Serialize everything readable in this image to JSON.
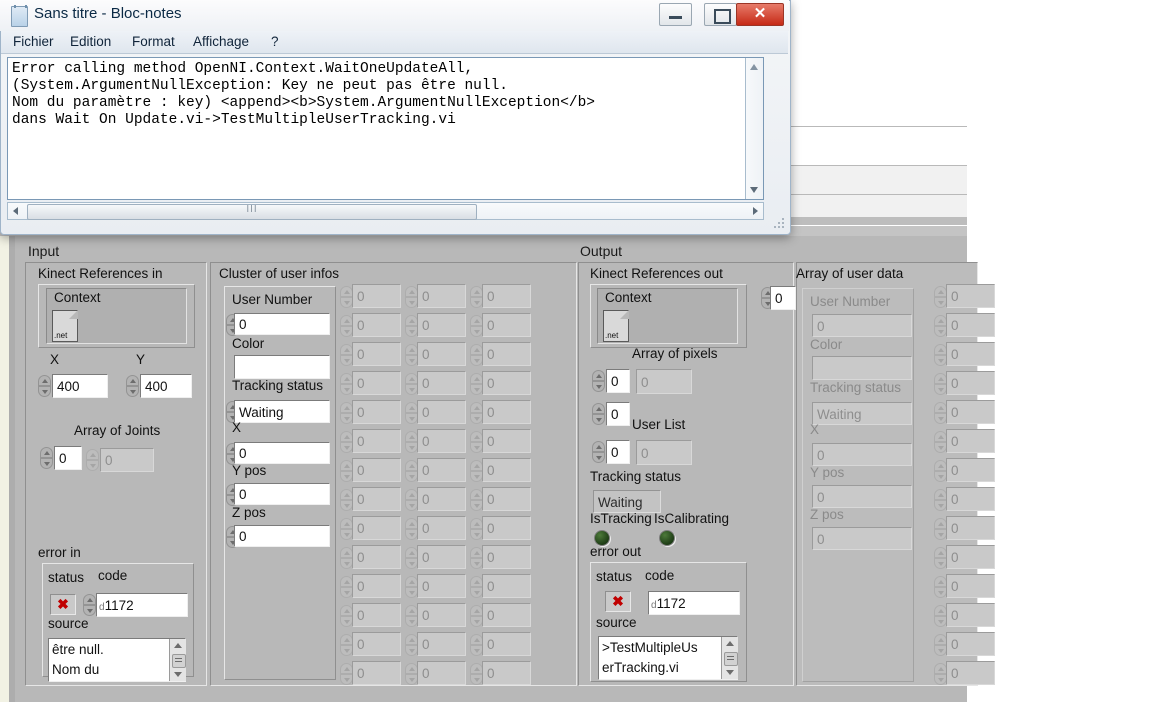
{
  "notepad": {
    "title": "Sans titre - Bloc-notes",
    "icon": "notepad-icon",
    "menus": [
      "Fichier",
      "Edition",
      "Format",
      "Affichage",
      "?"
    ],
    "buttons": {
      "minimize": "minimize-button",
      "maximize": "maximize-button",
      "close": "✕"
    },
    "text_lines": [
      "Error calling method OpenNI.Context.WaitOneUpdateAll,",
      "(System.ArgumentNullException: Key ne peut pas être null.",
      "Nom du paramètre : key) <append><b>System.ArgumentNullException</b>",
      "dans Wait On Update.vi->TestMultipleUserTracking.vi"
    ]
  },
  "panel": {
    "input": {
      "section_title": "Input",
      "kinect_refs": {
        "title": "Kinect References in",
        "context_label": "Context",
        "dotnet_badge": ".net",
        "x_label": "X",
        "x_value": "400",
        "y_label": "Y",
        "y_value": "400",
        "joints_label": "Array of Joints",
        "joints_index": "0",
        "joints_value": "0"
      },
      "error_in": {
        "title": "error in",
        "status_label": "status",
        "code_label": "code",
        "status_icon": "✖",
        "code_prefix": "d",
        "code_value": "1172",
        "source_label": "source",
        "source_lines": [
          "être null.",
          "Nom du"
        ]
      }
    },
    "cluster": {
      "title": "Cluster of user infos",
      "fields": [
        {
          "label": "User Number",
          "value": "0"
        },
        {
          "label": "Color",
          "value": ""
        },
        {
          "label": "Tracking status",
          "value": "Waiting"
        },
        {
          "label": "X",
          "value": "0"
        },
        {
          "label": "Y pos",
          "value": "0"
        },
        {
          "label": "Z pos",
          "value": "0"
        }
      ],
      "grid_columns": 3,
      "grid_rows": 14,
      "grid_value": "0"
    },
    "output": {
      "section_title": "Output",
      "kinect_refs": {
        "title": "Kinect References out",
        "context_label": "Context",
        "dotnet_badge": ".net",
        "pixels_label": "Array of pixels",
        "pixels_index_1": "0",
        "pixels_value_1": "0",
        "pixels_index_2": "0",
        "userlist_label": "User List",
        "userlist_index": "0",
        "userlist_value": "0",
        "tracking_label": "Tracking status",
        "tracking_value": "Waiting",
        "istracking_label": "IsTracking",
        "iscalibrating_label": "IsCalibrating"
      },
      "error_out": {
        "title": "error out",
        "status_label": "status",
        "code_label": "code",
        "status_icon": "✖",
        "code_prefix": "d",
        "code_value": "1172",
        "source_label": "source",
        "source_lines": [
          ">TestMultipleUs",
          "erTracking.vi"
        ]
      }
    },
    "user_data": {
      "title": "Array of user data",
      "index_value": "0",
      "fields": [
        {
          "label": "User Number",
          "value": "0"
        },
        {
          "label": "Color",
          "value": ""
        },
        {
          "label": "Tracking status",
          "value": "Waiting"
        },
        {
          "label": "X",
          "value": "0"
        },
        {
          "label": "Y pos",
          "value": "0"
        },
        {
          "label": "Z pos",
          "value": "0"
        }
      ],
      "grid_rows": 14,
      "grid_value": "0"
    }
  },
  "colors": {
    "panel_bg": "#b8b8b8",
    "control_bg": "#ffffff",
    "disabled_bg": "#c9c9c9",
    "error_red": "#c00000",
    "led_green": "#2f5a22",
    "titlebar_close": "#c62a16"
  }
}
